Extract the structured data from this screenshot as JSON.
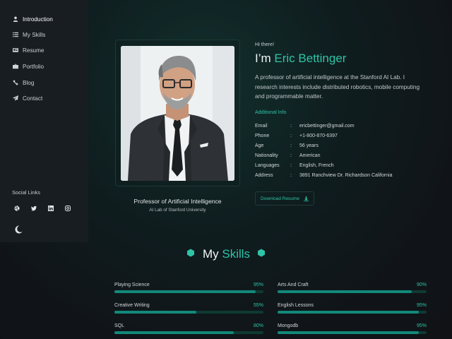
{
  "nav": {
    "items": [
      {
        "label": "Introduction",
        "icon": "user-icon"
      },
      {
        "label": "My Skills",
        "icon": "list-icon"
      },
      {
        "label": "Resume",
        "icon": "id-card-icon"
      },
      {
        "label": "Portfolio",
        "icon": "briefcase-icon"
      },
      {
        "label": "Blog",
        "icon": "satellite-icon"
      },
      {
        "label": "Contact",
        "icon": "paper-plane-icon"
      }
    ],
    "active_index": 0
  },
  "social": {
    "title": "Social Links",
    "icons": [
      "dribbble-icon",
      "twitter-icon",
      "linkedin-icon",
      "instagram-icon"
    ]
  },
  "theme_toggle": {
    "icon": "moon-icon"
  },
  "profile": {
    "greeting": "Hi there!",
    "name_prefix": "I’m",
    "name": "Eric Bettinger",
    "bio": "A professor of artificial intelligence at the Stanford AI Lab. I research interests include distributed robotics, mobile computing and programmable matter.",
    "card_title": "Professor of Artificial Intelligence",
    "card_subtitle": "AI Lab of Stanford University",
    "additional_title": "Additional Info",
    "info": [
      {
        "label": "Email",
        "value": "ericbettinger@gmail.com"
      },
      {
        "label": "Phone",
        "value": "+1-800-870-6397"
      },
      {
        "label": "Age",
        "value": "56 years"
      },
      {
        "label": "Nationality",
        "value": "American"
      },
      {
        "label": "Languages",
        "value": "English, French"
      },
      {
        "label": "Address",
        "value": "3891 Ranchview Dr. Richardson California"
      }
    ],
    "info_separator": ":",
    "download_label": "Download Resume"
  },
  "skills": {
    "title_prefix": "My",
    "title_accent": "Skills",
    "items": [
      {
        "name": "Playing Science",
        "percent": "95%",
        "value": 95
      },
      {
        "name": "Arts And Craft",
        "percent": "90%",
        "value": 90
      },
      {
        "name": "Creative Writing",
        "percent": "55%",
        "value": 55
      },
      {
        "name": "English Lessons",
        "percent": "95%",
        "value": 95
      },
      {
        "name": "SQL",
        "percent": "80%",
        "value": 80
      },
      {
        "name": "Mongodb",
        "percent": "95%",
        "value": 95
      }
    ]
  },
  "colors": {
    "accent": "#2ec4a6",
    "sidebar_bg": "#181d22",
    "bar_fill": "#12897a",
    "bar_track": "#0f3a34"
  }
}
